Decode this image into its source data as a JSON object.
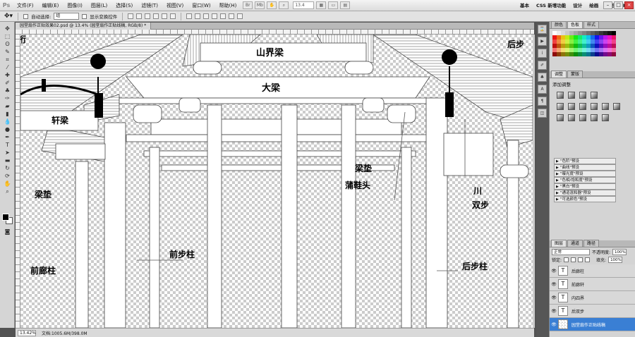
{
  "app": {
    "logo": "Ps"
  },
  "menu": [
    "文件(F)",
    "编辑(E)",
    "图像(I)",
    "图层(L)",
    "选择(S)",
    "滤镜(T)",
    "视图(V)",
    "窗口(W)",
    "帮助(H)"
  ],
  "zoom_menu": "13.4",
  "workspaces": [
    "基本",
    "CSS 新增功能",
    "设计",
    "绘画",
    "摄影",
    "3D"
  ],
  "options": {
    "auto_select_label": "自动选择:",
    "auto_select_value": "组",
    "show_transform_label": "显示变换控件"
  },
  "document_tab": "园堂扇作正贴效果02.psd @ 13.4% (园堂扇作正贴线稿, RGB/8) *",
  "status": {
    "zoom": "13.42%",
    "doc": "文档:1005.6M/398.0M"
  },
  "drawing_labels": {
    "shanjieliang": "山界梁",
    "daliang": "大梁",
    "xuanliang": "轩梁",
    "liangdian_left": "梁垫",
    "liangdian_right": "梁垫",
    "puxietou": "蒲鞋头",
    "chuan": "川",
    "shuangbu": "双步",
    "qianbuzhu": "前步柱",
    "qianlangzhu": "前廊柱",
    "houbuzhu": "后步柱",
    "houbu_top": "后步",
    "heng_top": "桁"
  },
  "panels": {
    "color_tabs": [
      "颜色",
      "色板",
      "样式"
    ],
    "adjust_tabs": [
      "调整",
      "蒙版"
    ],
    "adjust_title": "添加调整",
    "presets": [
      "\"色阶\"预设",
      "\"曲线\"预设",
      "\"曝光度\"预设",
      "\"色相/饱和度\"预设",
      "\"黑白\"预设",
      "\"通道混和器\"预设",
      "\"可选颜色\"预设"
    ],
    "layers_tabs": [
      "图层",
      "通道",
      "路径"
    ],
    "blend_mode": "正常",
    "opacity_label": "不透明度:",
    "opacity": "100%",
    "lock_label": "锁定:",
    "fill_label": "填充:",
    "fill": "100%",
    "layers": [
      "后廊柱",
      "前廊轩",
      "内四界",
      "后双步",
      "园堂扇作正贴线稿"
    ]
  },
  "colors": {
    "selected_layer": "#3a7fd4"
  }
}
